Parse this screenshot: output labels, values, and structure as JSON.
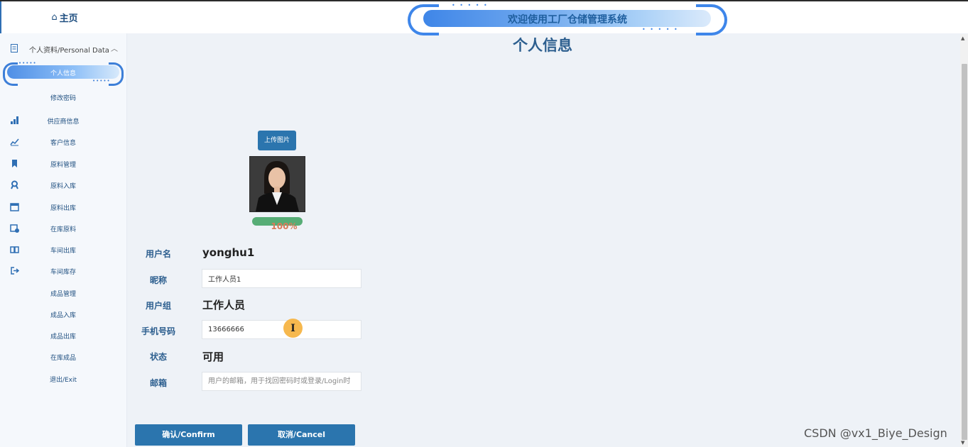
{
  "header": {
    "banner_title": "欢迎使用工厂仓储管理系统"
  },
  "sidebar": {
    "home": {
      "icon": "home-icon",
      "label": "主页"
    },
    "group": {
      "icon": "document-icon",
      "label": "个人资料/Personal Data",
      "expanded": true
    },
    "active_item": "个人信息",
    "items": [
      {
        "label": "修改密码",
        "icon": ""
      },
      {
        "label": "供应商信息",
        "icon": "chart-bar-icon"
      },
      {
        "label": "客户信息",
        "icon": "chart-line-icon"
      },
      {
        "label": "原料管理",
        "icon": "bookmark-icon"
      },
      {
        "label": "原料入库",
        "icon": "user-badge-icon"
      },
      {
        "label": "原料出库",
        "icon": "calendar-icon"
      },
      {
        "label": "在库原料",
        "icon": "calendar-check-icon"
      },
      {
        "label": "车间出库",
        "icon": "book-icon"
      },
      {
        "label": "车间库存",
        "icon": "logout-icon"
      },
      {
        "label": "成品管理",
        "icon": ""
      },
      {
        "label": "成品入库",
        "icon": ""
      },
      {
        "label": "成品出库",
        "icon": ""
      },
      {
        "label": "在库成品",
        "icon": ""
      },
      {
        "label": "退出/Exit",
        "icon": ""
      }
    ]
  },
  "main": {
    "title": "个人信息",
    "upload_label": "上传图片",
    "progress": {
      "text": "100%",
      "value": 1.0
    },
    "fields": {
      "username": {
        "label": "用户名",
        "value": "yonghu1"
      },
      "nickname": {
        "label": "昵称",
        "value": "工作人员1"
      },
      "group": {
        "label": "用户组",
        "value": "工作人员"
      },
      "phone": {
        "label": "手机号码",
        "value": "13666666"
      },
      "status": {
        "label": "状态",
        "value": "可用"
      },
      "email": {
        "label": "邮箱",
        "placeholder": "用户的邮箱，用于找回密码时或登录/Login时"
      }
    },
    "cursor_glyph": "I",
    "confirm_label": "确认/Confirm",
    "cancel_label": "取消/Cancel"
  },
  "watermark": "CSDN @vx1_Biye_Design",
  "colors": {
    "primary_button": "#2b75ae",
    "label_text": "#2d5f8f",
    "progress": "#57ad76",
    "accent": "#3e86ea"
  }
}
